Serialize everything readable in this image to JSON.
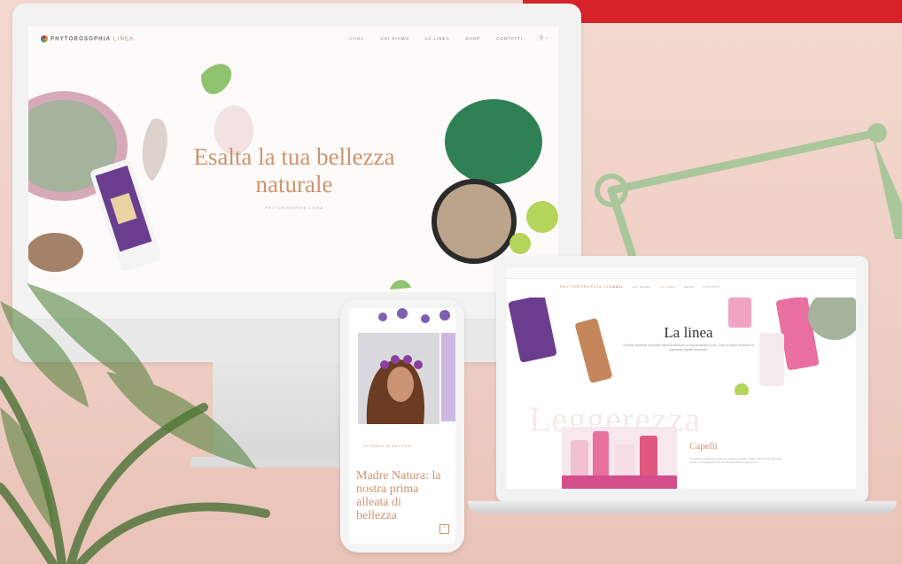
{
  "desktop": {
    "logo": {
      "brand": "PHYTOROSOPHIA",
      "accent": "LINEA"
    },
    "nav": [
      "HOME",
      "CHI SIAMO",
      "LA LINEA",
      "SHOP",
      "CONTATTI"
    ],
    "hero_title": "Esalta la tua bellezza naturale",
    "hero_subtitle": "PHYTOROSOPHIA LINEA"
  },
  "phone": {
    "kicker": "SCIENZA & NATURA",
    "title": "Madre Natura: la nostra prima alleata di bellezza"
  },
  "laptop": {
    "logo": "PHYTOROSOPHIA LINEA",
    "nav": [
      "HOME",
      "CHI SIAMO",
      "LA LINEA",
      "SHOP",
      "CONTATTI"
    ],
    "page_title": "La linea",
    "intro_text": "Un'ampia selezione di prodotti naturali pensati per la cura quotidiana di viso, corpo e capelli, formulati con ingredienti vegetali selezionati.",
    "watermark": "Leggerezza",
    "section_title": "Capelli",
    "section_text": "Prodotti per capelli formulati con estratti vegetali e argille naturali per detergere, nutrire e proteggere la chioma con delicatezza ogni giorno."
  },
  "colors": {
    "background": "#efcfc5",
    "accent": "#cf9470",
    "banner": "#d8222a"
  }
}
